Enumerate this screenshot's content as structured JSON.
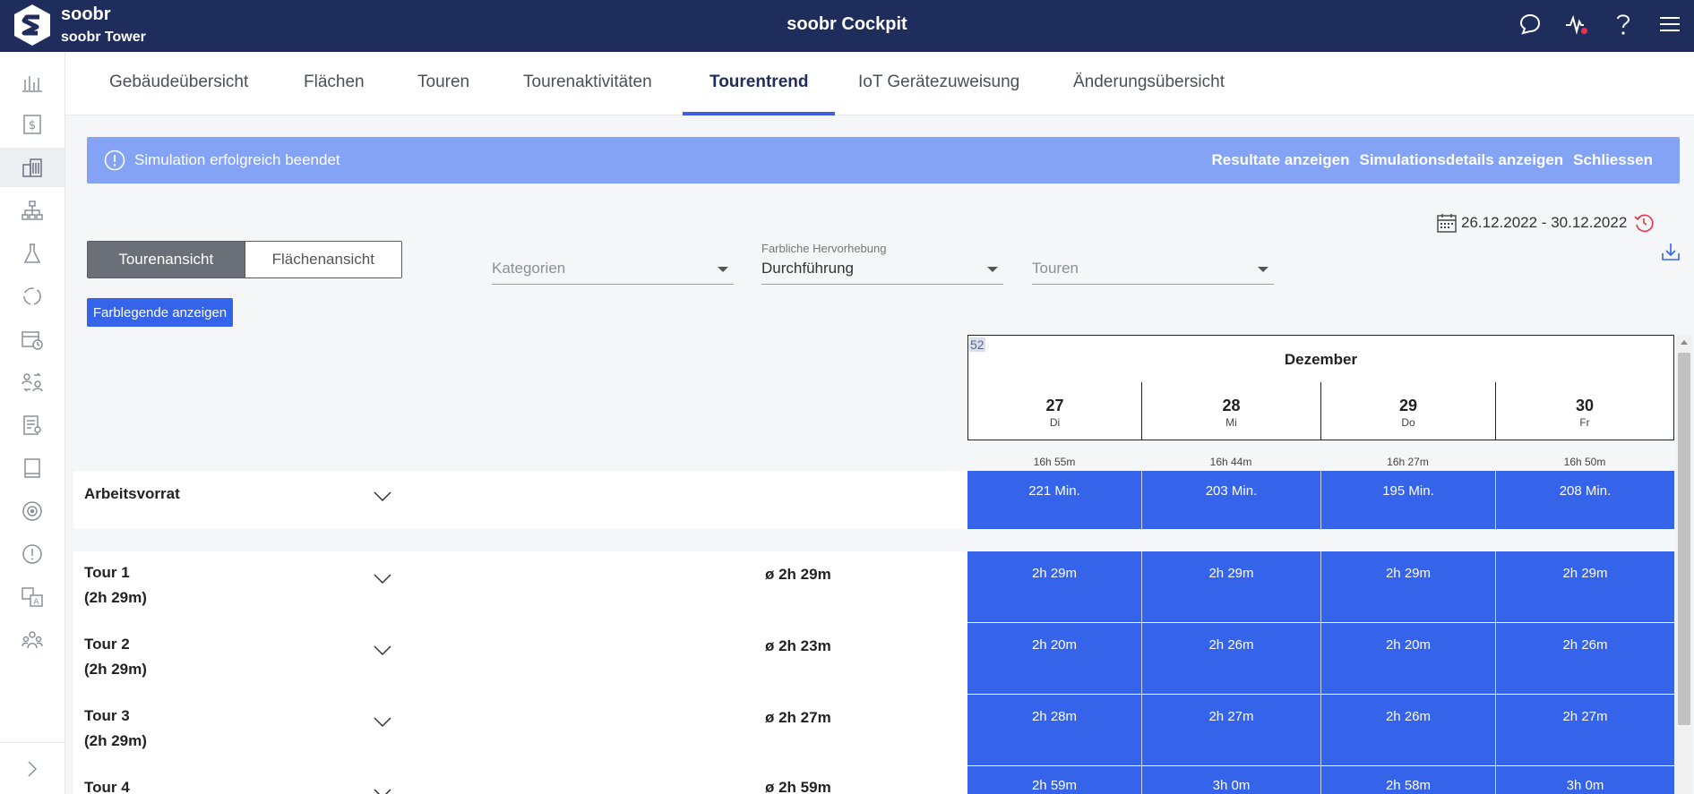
{
  "header": {
    "brand": "soobr",
    "building": "soobr Tower",
    "app_title": "soobr Cockpit"
  },
  "tabs": [
    "Gebäudeübersicht",
    "Flächen",
    "Touren",
    "Tourenaktivitäten",
    "Tourentrend",
    "IoT Gerätezuweisung",
    "Änderungsübersicht"
  ],
  "active_tab": "Tourentrend",
  "banner": {
    "message": "Simulation erfolgreich beendet",
    "show_results": "Resultate anzeigen",
    "show_details": "Simulationsdetails anzeigen",
    "close": "Schliessen"
  },
  "view_toggle": {
    "tour_view": "Tourenansicht",
    "area_view": "Flächenansicht"
  },
  "filters": {
    "categories_placeholder": "Kategorien",
    "highlight_label": "Farbliche Hervorhebung",
    "highlight_value": "Durchführung",
    "tours_placeholder": "Touren"
  },
  "date_range": "26.12.2022 - 30.12.2022",
  "legend_button": "Farblegende anzeigen",
  "calendar": {
    "week": "52",
    "month": "Dezember",
    "days": [
      {
        "num": "27",
        "weekday": "Di",
        "total": "16h 55m"
      },
      {
        "num": "28",
        "weekday": "Mi",
        "total": "16h 44m"
      },
      {
        "num": "29",
        "weekday": "Do",
        "total": "16h 27m"
      },
      {
        "num": "30",
        "weekday": "Fr",
        "total": "16h 50m"
      }
    ]
  },
  "backlog": {
    "label": "Arbeitsvorrat",
    "values": [
      "221 Min.",
      "203 Min.",
      "195 Min.",
      "208 Min."
    ]
  },
  "tours": [
    {
      "name": "Tour 1",
      "planned": "(2h 29m)",
      "avg": "ø 2h 29m",
      "values": [
        "2h 29m",
        "2h 29m",
        "2h 29m",
        "2h 29m"
      ]
    },
    {
      "name": "Tour 2",
      "planned": "(2h 29m)",
      "avg": "ø 2h 23m",
      "values": [
        "2h 20m",
        "2h 26m",
        "2h 20m",
        "2h 26m"
      ]
    },
    {
      "name": "Tour 3",
      "planned": "(2h 29m)",
      "avg": "ø 2h 27m",
      "values": [
        "2h 28m",
        "2h 27m",
        "2h 26m",
        "2h 27m"
      ]
    },
    {
      "name": "Tour 4",
      "planned": "",
      "avg": "ø 2h 59m",
      "values": [
        "2h 59m",
        "3h 0m",
        "2h 58m",
        "3h 0m"
      ]
    }
  ],
  "colors": {
    "header_bg": "#1f2d5c",
    "accent": "#3563ea",
    "banner_bg": "#84a3f4",
    "alert_dot": "#e8334a"
  }
}
